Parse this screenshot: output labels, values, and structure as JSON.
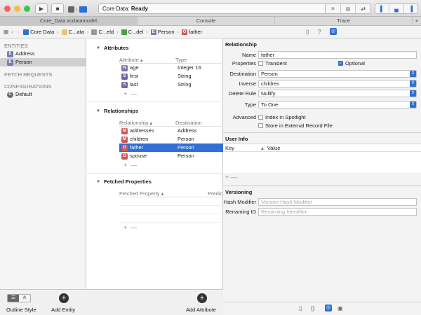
{
  "toolbar": {
    "status_prefix": "Core Data:",
    "status_value": "Ready"
  },
  "tabs": [
    {
      "label": "Core_Data.xcdatamodel"
    },
    {
      "label": "Console"
    },
    {
      "label": "Trace"
    }
  ],
  "jumpbar": {
    "crumbs": [
      "Core Data",
      "C...ata",
      "C...eld",
      "C...del",
      "Person",
      "father"
    ]
  },
  "sidebar": {
    "entities_title": "ENTITIES",
    "entities": [
      {
        "badge": "E",
        "label": "Address"
      },
      {
        "badge": "E",
        "label": "Person"
      }
    ],
    "fetch_title": "FETCH REQUESTS",
    "config_title": "CONFIGURATIONS",
    "configs": [
      {
        "badge": "C",
        "label": "Default"
      }
    ]
  },
  "bottom": {
    "outline_style": "Outline Style",
    "add_entity": "Add Entity",
    "add_attribute": "Add Attribute"
  },
  "attributes": {
    "title": "Attributes",
    "col1": "Attribute",
    "col2": "Type",
    "rows": [
      {
        "badge": "N",
        "name": "age",
        "type": "Integer 16"
      },
      {
        "badge": "S",
        "name": "first",
        "type": "String"
      },
      {
        "badge": "S",
        "name": "last",
        "type": "String"
      }
    ]
  },
  "relationships": {
    "title": "Relationships",
    "col1": "Relationship",
    "col2": "Destination",
    "rows": [
      {
        "badge": "M",
        "name": "addresses",
        "dest": "Address"
      },
      {
        "badge": "M",
        "name": "children",
        "dest": "Person"
      },
      {
        "badge": "O",
        "name": "father",
        "dest": "Person"
      },
      {
        "badge": "O",
        "name": "spouse",
        "dest": "Person"
      }
    ]
  },
  "fetched": {
    "title": "Fetched Properties",
    "col1": "Fetched Property",
    "col2": "Predic"
  },
  "inspector": {
    "relationship_title": "Relationship",
    "name_label": "Name",
    "name_value": "father",
    "properties_label": "Properties",
    "transient": "Transient",
    "optional": "Optional",
    "destination_label": "Destination",
    "destination_value": "Person",
    "inverse_label": "Inverse",
    "inverse_value": "children",
    "delete_label": "Delete Rule",
    "delete_value": "Nullify",
    "type_label": "Type",
    "type_value": "To One",
    "advanced_label": "Advanced",
    "spotlight": "Index in Spotlight",
    "external": "Store in External Record File",
    "userinfo_title": "User Info",
    "key_col": "Key",
    "value_col": "Value",
    "versioning_title": "Versioning",
    "hash_label": "Hash Modifier",
    "hash_placeholder": "Version Hash Modifier",
    "renaming_label": "Renaming ID",
    "renaming_placeholder": "Renaming Identifier"
  },
  "colors": {
    "accent": "#2f6fd6",
    "selection": "#2f6fd6",
    "close": "#fc605c",
    "minimize": "#fdbc40",
    "zoom": "#34c84a"
  }
}
